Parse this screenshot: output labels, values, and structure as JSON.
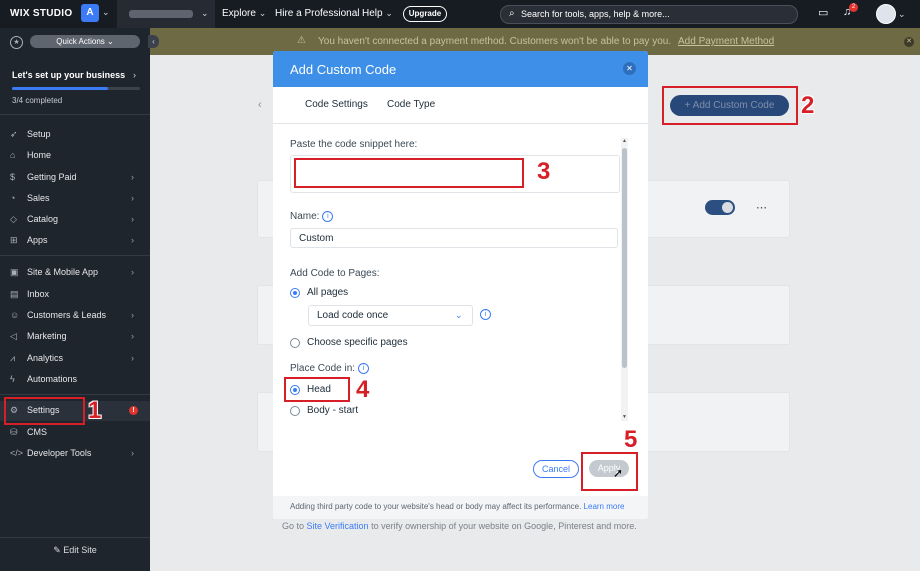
{
  "topbar": {
    "logo": "WIX STUDIO",
    "workspace_initial": "A",
    "nav": [
      "Explore",
      "Hire a Professional",
      "Help"
    ],
    "upgrade_label": "Upgrade",
    "search_placeholder": "Search for tools, apps, help & more...",
    "notification_count": "2"
  },
  "sidebar": {
    "quick_actions_label": "Quick Actions",
    "setup_title": "Let's set up your business",
    "setup_progress": 0.75,
    "setup_completed": "3/4 completed",
    "items": [
      {
        "label": "Setup",
        "icon": "rocket-icon"
      },
      {
        "label": "Home",
        "icon": "home-icon"
      },
      {
        "label": "Getting Paid",
        "icon": "dollar-icon"
      },
      {
        "label": "Sales",
        "icon": "sales-icon"
      },
      {
        "label": "Catalog",
        "icon": "tag-icon"
      },
      {
        "label": "Apps",
        "icon": "apps-icon"
      },
      {
        "label": "Site & Mobile App",
        "icon": "layout-icon"
      },
      {
        "label": "Inbox",
        "icon": "inbox-icon"
      },
      {
        "label": "Customers & Leads",
        "icon": "people-icon"
      },
      {
        "label": "Marketing",
        "icon": "megaphone-icon"
      },
      {
        "label": "Analytics",
        "icon": "analytics-icon"
      },
      {
        "label": "Automations",
        "icon": "automation-icon"
      },
      {
        "label": "Settings",
        "icon": "gear-icon"
      },
      {
        "label": "CMS",
        "icon": "database-icon"
      },
      {
        "label": "Developer Tools",
        "icon": "code-icon"
      }
    ],
    "edit_site_label": "Edit Site"
  },
  "banner": {
    "text": "You haven't connected a payment method. Customers won't be able to pay you.",
    "link": "Add Payment Method"
  },
  "main": {
    "add_custom_code_label": "Add Custom Code",
    "bullet_prefix": "Go to",
    "bullet_link": "Site Verification",
    "bullet_suffix": "to verify ownership of your website on Google, Pinterest and more."
  },
  "modal": {
    "title": "Add Custom Code",
    "tabs": [
      "Code Settings",
      "Code Type"
    ],
    "snippet_label": "Paste the code snippet here:",
    "name_label": "Name:",
    "name_value": "Custom",
    "pages_label": "Add Code to Pages:",
    "all_pages_label": "All pages",
    "load_option": "Load code once",
    "specific_pages_label": "Choose specific pages",
    "place_label": "Place Code in:",
    "head_label": "Head",
    "body_start_label": "Body - start",
    "cancel_label": "Cancel",
    "apply_label": "Apply",
    "footer_text": "Adding third party code to your website's head or body may affect its performance.",
    "footer_link": "Learn more"
  },
  "callouts": [
    "1",
    "2",
    "3",
    "4",
    "5"
  ],
  "colors": {
    "accent": "#3b7cf6",
    "modal_header": "#3d8fe8",
    "callout": "#d61f26",
    "sidebar": "#1f252d"
  }
}
